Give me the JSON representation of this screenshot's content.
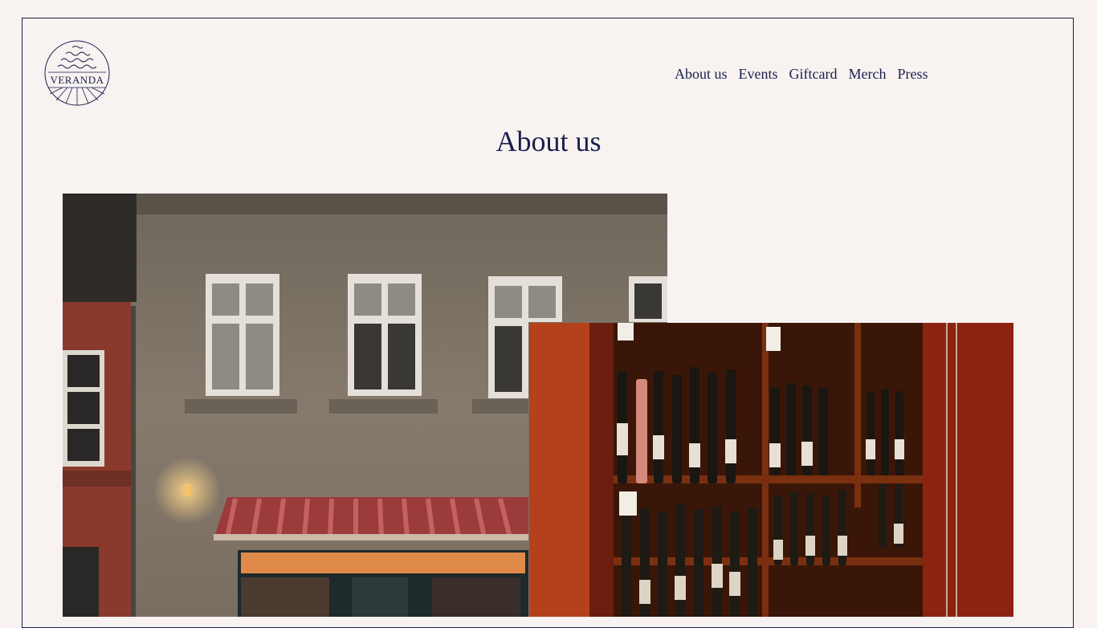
{
  "brand": {
    "logo_text": "VERANDA"
  },
  "nav": {
    "items": [
      {
        "label": "About us"
      },
      {
        "label": "Events"
      },
      {
        "label": "Giftcard"
      },
      {
        "label": "Merch"
      },
      {
        "label": "Press"
      }
    ]
  },
  "page": {
    "title": "About us"
  },
  "colors": {
    "ink": "#1a1f4d",
    "background": "#f8f2f1"
  },
  "images": {
    "facade": {
      "alt": ""
    },
    "shelf": {
      "alt": ""
    }
  }
}
